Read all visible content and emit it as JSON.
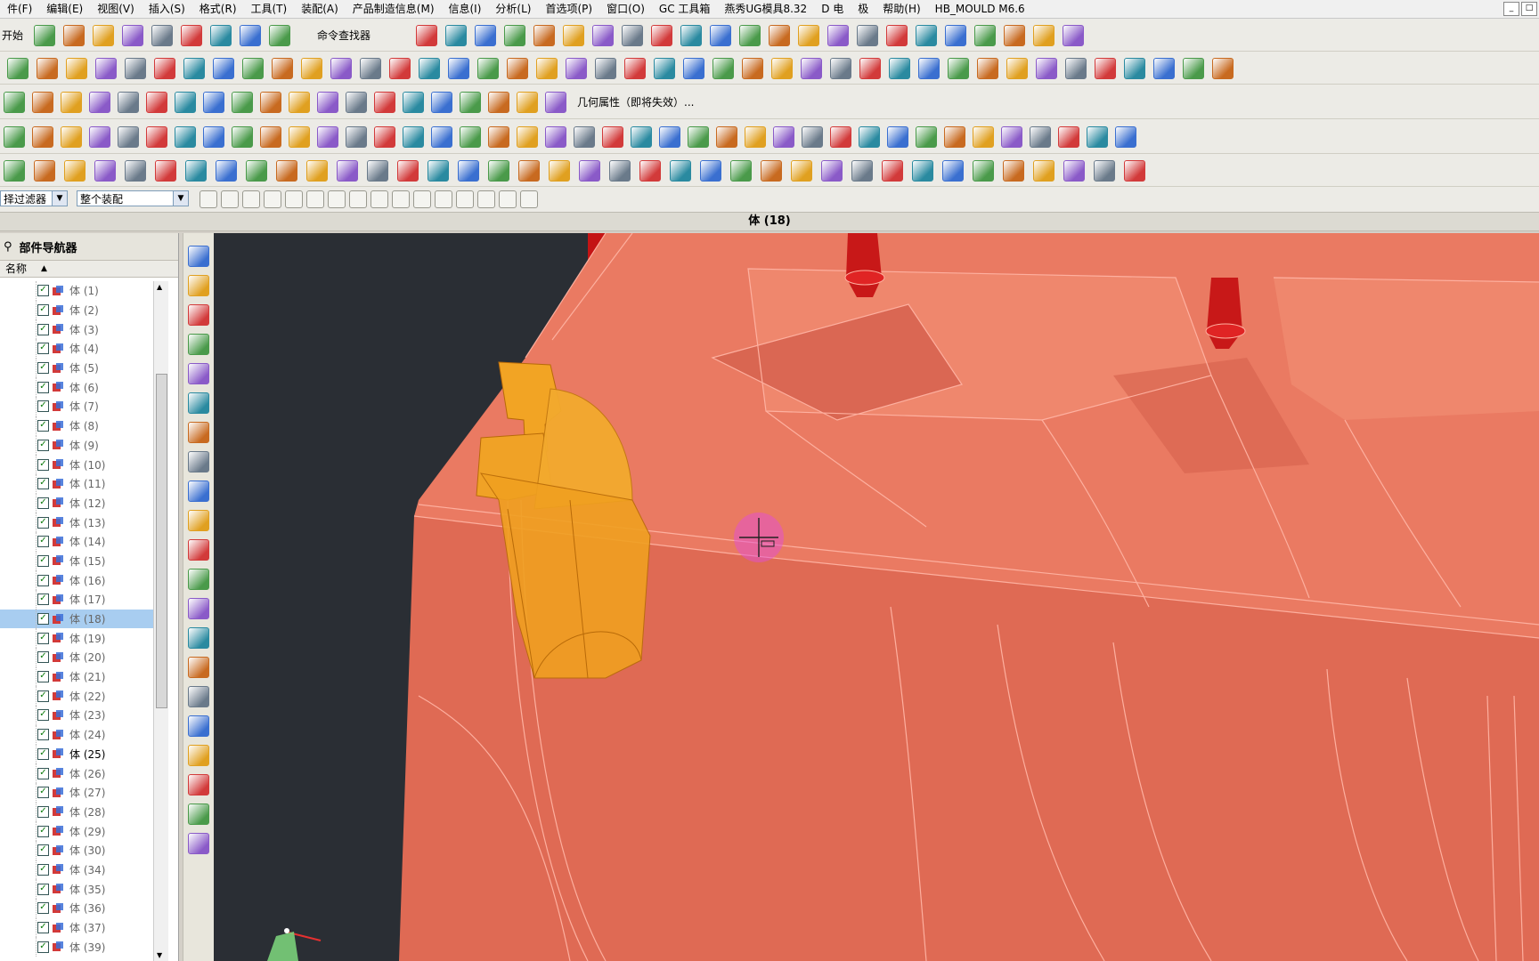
{
  "menu": [
    "件(F)",
    "编辑(E)",
    "视图(V)",
    "插入(S)",
    "格式(R)",
    "工具(T)",
    "装配(A)",
    "产品制造信息(M)",
    "信息(I)",
    "分析(L)",
    "首选项(P)",
    "窗口(O)",
    "GC 工具箱",
    "燕秀UG模具8.32",
    "D 电",
    "极",
    "帮助(H)",
    "HB_MOULD M6.6"
  ],
  "toolbar": {
    "start_label": "开始",
    "command_finder_label": "命令查找器",
    "geometry_properties_label": "几何属性（即将失效）..."
  },
  "filter": {
    "selection_filter_value": "择过滤器",
    "scope_value": "整个装配"
  },
  "viewport_title": "体 (18)",
  "navigator": {
    "title": "部件导航器",
    "column_name": "名称",
    "selected_index": 17,
    "dark_index": 24,
    "rows": [
      "体 (1)",
      "体 (2)",
      "体 (3)",
      "体 (4)",
      "体 (5)",
      "体 (6)",
      "体 (7)",
      "体 (8)",
      "体 (9)",
      "体 (10)",
      "体 (11)",
      "体 (12)",
      "体 (13)",
      "体 (14)",
      "体 (15)",
      "体 (16)",
      "体 (17)",
      "体 (18)",
      "体 (19)",
      "体 (20)",
      "体 (21)",
      "体 (22)",
      "体 (23)",
      "体 (24)",
      "体 (25)",
      "体 (26)",
      "体 (27)",
      "体 (28)",
      "体 (29)",
      "体 (30)",
      "体 (34)",
      "体 (35)",
      "体 (36)",
      "体 (37)",
      "体 (39)"
    ]
  },
  "colors": {
    "mold_body": "#e8735e",
    "mold_edge": "#ffb0a0",
    "insert_body": "#f0a020",
    "red_parts": "#d01818",
    "viewport_bg": "#2a2e34",
    "selected_row": "#a8cdf0"
  }
}
